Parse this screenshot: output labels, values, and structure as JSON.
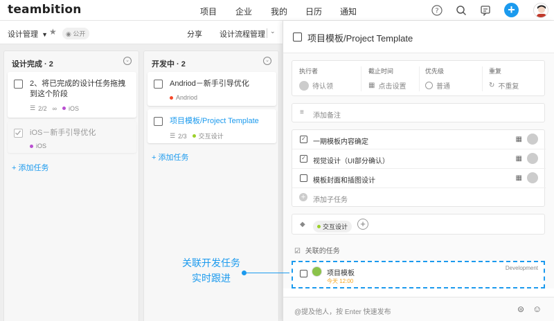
{
  "app": {
    "logo": "teambition"
  },
  "topnav": {
    "items": [
      "项目",
      "企业",
      "我的",
      "日历",
      "通知"
    ]
  },
  "project": {
    "name": "设计管理",
    "visibility": "公开",
    "tabs": [
      "分享",
      "设计流程管理"
    ]
  },
  "columns": [
    {
      "title": "设计完成 · 2",
      "cards": [
        {
          "title": "2、将已完成的设计任务拖拽到这个阶段",
          "subtasks": "2/2",
          "tag": "iOS",
          "tag_color": "#b94fd0",
          "done": false
        },
        {
          "title": "iOS－新手引导优化",
          "tag": "iOS",
          "tag_color": "#b94fd0",
          "done": true
        }
      ],
      "add_label": "添加任务"
    },
    {
      "title": "开发中 · 2",
      "cards": [
        {
          "title": "Andriod－新手引导优化",
          "tag": "Andriod",
          "tag_color": "#f5492a",
          "done": false
        },
        {
          "title": "项目模板/Project Template",
          "subtasks": "2/3",
          "tag": "交互设计",
          "tag_color": "#9cd02a",
          "done": false
        }
      ],
      "add_label": "添加任务"
    }
  ],
  "detail": {
    "title": "项目模板/Project Template",
    "fields": {
      "assignee_label": "执行者",
      "assignee_value": "待认领",
      "due_label": "截止时间",
      "due_value": "点击设置",
      "priority_label": "优先级",
      "priority_value": "普通",
      "repeat_label": "重复",
      "repeat_value": "不重复"
    },
    "note_placeholder": "添加备注",
    "subtasks": [
      {
        "text": "一期模板内容确定",
        "checked": true
      },
      {
        "text": "视觉设计（UI部分确认）",
        "checked": true
      },
      {
        "text": "模板封面和插图设计",
        "checked": false
      }
    ],
    "add_subtask": "添加子任务",
    "tag": "交互设计",
    "linked_label": "关联的任务",
    "linked_task": {
      "title": "项目模板",
      "due": "今天 12:00",
      "project": "Development"
    },
    "comment_placeholder": "@提及他人，按 Enter 快速发布"
  },
  "callout": {
    "line1": "关联开发任务",
    "line2": "实时跟进"
  },
  "colors": {
    "accent": "#1b9aee",
    "due_today": "#f5a623"
  }
}
